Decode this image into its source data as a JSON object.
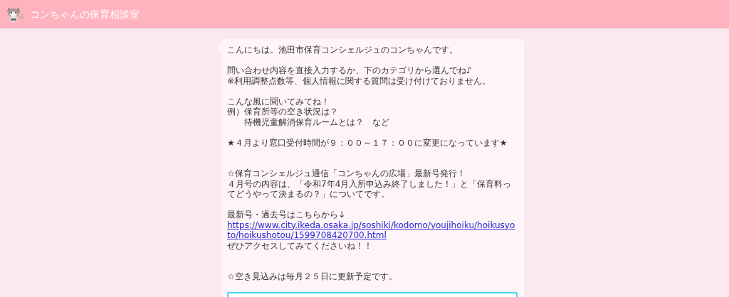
{
  "header": {
    "title": "コンちゃんの保育相談室"
  },
  "message": {
    "blocks": [
      {
        "kind": "text",
        "lines": [
          {
            "kind": "text",
            "text": "こんにちは。池田市保育コンシェルジュのコンちゃんです。"
          }
        ]
      },
      {
        "kind": "text",
        "lines": [
          {
            "kind": "text",
            "text": "問い合わせ内容を直接入力するか、下のカテゴリから選んでね♪"
          },
          {
            "kind": "text",
            "text": "※利用調整点数等、個人情報に関する質問は受け付けておりません。"
          }
        ]
      },
      {
        "kind": "text",
        "lines": [
          {
            "kind": "text",
            "text": "こんな風に聞いてみてね！"
          },
          {
            "kind": "text",
            "text": "例）保育所等の空き状況は？"
          },
          {
            "kind": "text",
            "text": "　　待機児童解消保育ルームとは？　など"
          }
        ]
      },
      {
        "kind": "text",
        "lines": [
          {
            "kind": "text",
            "text": "★４月より窓口受付時間が９：００～１７：００に変更になっています★"
          }
        ]
      },
      {
        "kind": "break"
      },
      {
        "kind": "text",
        "lines": [
          {
            "kind": "text",
            "text": "☆保育コンシェルジュ通信「コンちゃんの広場」最新号発行！"
          },
          {
            "kind": "text",
            "text": "４月号の内容は、「令和7年4月入所申込み終了しました！」と「保育料ってどうやって決まるの？」についてです。"
          }
        ]
      },
      {
        "kind": "text",
        "lines": [
          {
            "kind": "text",
            "text": "最新号・過去号はこちらから↓"
          },
          {
            "kind": "link",
            "text": "https://www.city.ikeda.osaka.jp/soshiki/kodomo/youjihoiku/hoikusyoto/hoikushotou/1599708420700.html"
          },
          {
            "kind": "text",
            "text": "ぜひアクセスしてみてくださいね！！"
          }
        ]
      },
      {
        "kind": "break"
      },
      {
        "kind": "text",
        "lines": [
          {
            "kind": "text",
            "text": "☆空き見込みは毎月２５日に更新予定です。"
          }
        ]
      }
    ]
  },
  "input": {
    "focused": true
  }
}
